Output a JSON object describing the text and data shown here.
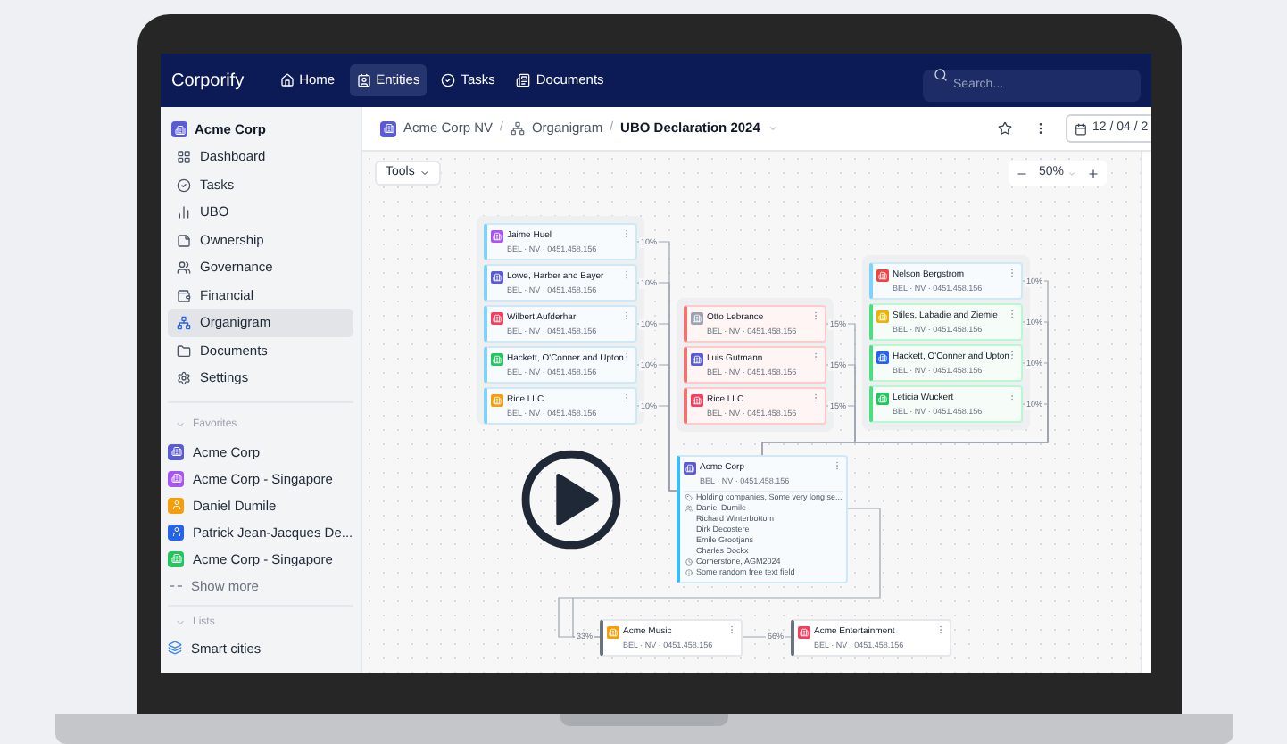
{
  "navbar": {
    "logo": "Corporify",
    "items": [
      {
        "label": "Home",
        "selected": false
      },
      {
        "label": "Entities",
        "selected": true
      },
      {
        "label": "Tasks",
        "selected": false
      },
      {
        "label": "Documents",
        "selected": false
      }
    ],
    "search": {
      "placeholder": "Search..."
    }
  },
  "sidebar": {
    "entity": {
      "name": "Acme Corp",
      "color": "#5b5bd6"
    },
    "items": [
      {
        "label": "Dashboard",
        "selected": false
      },
      {
        "label": "Tasks",
        "selected": false
      },
      {
        "label": "UBO",
        "selected": false
      },
      {
        "label": "Ownership",
        "selected": false
      },
      {
        "label": "Governance",
        "selected": false
      },
      {
        "label": "Financial",
        "selected": false
      },
      {
        "label": "Organigram",
        "selected": true
      },
      {
        "label": "Documents",
        "selected": false
      },
      {
        "label": "Settings",
        "selected": false
      }
    ],
    "favorites_title": "Favorites",
    "favorites": [
      {
        "label": "Acme Corp",
        "kind": "company",
        "color": "#5b5bd6"
      },
      {
        "label": "Acme Corp - Singapore",
        "kind": "company",
        "color": "#a855f7"
      },
      {
        "label": "Daniel Dumile",
        "kind": "person",
        "color": "#f59e0b"
      },
      {
        "label": "Patrick Jean-Jacques De...",
        "kind": "person",
        "color": "#2563eb"
      },
      {
        "label": "Acme Corp - Singapore",
        "kind": "company",
        "color": "#22c55e"
      }
    ],
    "show_more": "Show more",
    "lists_title": "Lists",
    "lists": [
      {
        "label": "Smart cities"
      }
    ]
  },
  "header": {
    "breadcrumbs": [
      {
        "label": "Acme Corp NV",
        "kind": "entity"
      },
      {
        "separator": "/",
        "label": "Organigram",
        "kind": "organigram"
      },
      {
        "separator": "/",
        "label": "UBO Declaration 2024",
        "kind": "current"
      }
    ],
    "date": "12 / 04 / 2"
  },
  "canvas": {
    "tools": "Tools",
    "zoom": "50%",
    "left_nodes": [
      {
        "name": "Jaime Huel",
        "sub": "BEL · NV · 0451.458.156",
        "color": "#a855f7",
        "kind": "info",
        "share": "10%"
      },
      {
        "name": "Lowe, Harber and Bayer",
        "sub": "BEL · NV · 0451.458.156",
        "color": "#5b5bd6",
        "kind": "info",
        "share": "10%"
      },
      {
        "name": "Wilbert Aufderhar",
        "sub": "BEL · NV · 0451.458.156",
        "color": "#f43f5e",
        "kind": "info",
        "share": "10%"
      },
      {
        "name": "Hackett, O'Conner and Upton",
        "sub": "BEL · NV · 0451.458.156",
        "color": "#22c55e",
        "kind": "info",
        "share": "10%"
      },
      {
        "name": "Rice LLC",
        "sub": "BEL · NV · 0451.458.156",
        "color": "#f59e0b",
        "kind": "info",
        "share": "10%"
      }
    ],
    "middle_nodes": [
      {
        "name": "Otto Lebrance",
        "sub": "BEL · NV · 0451.458.156",
        "color": "#9ca3af",
        "kind": "danger",
        "share": "15%"
      },
      {
        "name": "Luis Gutmann",
        "sub": "BEL · NV · 0451.458.156",
        "color": "#5b5bd6",
        "kind": "danger",
        "share": "15%"
      },
      {
        "name": "Rice LLC",
        "sub": "BEL · NV · 0451.458.156",
        "color": "#f43f5e",
        "kind": "danger",
        "share": "15%"
      }
    ],
    "right_nodes": [
      {
        "name": "Nelson Bergstrom",
        "sub": "BEL · NV · 0451.458.156",
        "color": "#ef4444",
        "kind": "info",
        "share": "10%"
      },
      {
        "name": "Stiles, Labadie and Ziemie",
        "sub": "BEL · NV · 0451.458.156",
        "color": "#eab308",
        "kind": "success",
        "share": "10%"
      },
      {
        "name": "Hackett, O'Conner and Upton",
        "sub": "BEL · NV · 0451.458.156",
        "color": "#2563eb",
        "kind": "success",
        "share": "10%"
      },
      {
        "name": "Leticia Wuckert",
        "sub": "BEL · NV · 0451.458.156",
        "color": "#22c55e",
        "kind": "success",
        "share": "10%"
      }
    ],
    "main_node": {
      "name": "Acme Corp",
      "sub": "BEL · NV · 0451.458.156",
      "color": "#5b5bd6",
      "details": [
        {
          "kind": "tag",
          "text": "Holding companies, Some very long se..."
        },
        {
          "kind": "people",
          "text": "Daniel Dumile"
        },
        {
          "kind": "more",
          "text": "Richard Winterbottom"
        },
        {
          "kind": "more",
          "text": "Dirk Decostere"
        },
        {
          "kind": "more",
          "text": "Emile Grootjans"
        },
        {
          "kind": "more",
          "text": "Charles Dockx"
        },
        {
          "kind": "date",
          "text": "Cornerstone, AGM2024"
        },
        {
          "kind": "note",
          "text": "Some random free text field"
        }
      ]
    },
    "bottom_nodes": [
      {
        "name": "Acme Music",
        "sub": "BEL · NV · 0451.458.156",
        "color": "#f59e0b",
        "share": "33%"
      },
      {
        "name": "Acme Entertainment",
        "sub": "BEL · NV · 0451.458.156",
        "color": "#f43f5e",
        "share": "66%"
      }
    ]
  }
}
